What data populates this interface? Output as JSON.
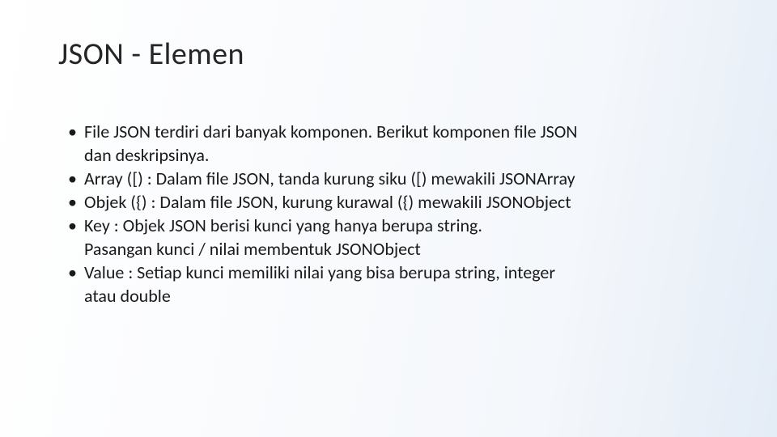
{
  "slide": {
    "title": "JSON - Elemen",
    "bullets": [
      {
        "line1": "File JSON terdiri dari banyak komponen. Berikut komponen file JSON",
        "line2": "dan deskripsinya."
      },
      {
        "line1": "Array ([)  : Dalam file JSON, tanda kurung siku ([) mewakili JSONArray"
      },
      {
        "line1": "Objek ({) : Dalam file JSON, kurung kurawal ({) mewakili JSONObject"
      },
      {
        "line1": "Key          : Objek JSON berisi kunci yang hanya berupa string.",
        "line2": "Pasangan kunci / nilai membentuk JSONObject"
      },
      {
        "line1": "Value      : Setiap kunci memiliki nilai yang bisa berupa string, integer",
        "line2": "atau double"
      }
    ]
  }
}
